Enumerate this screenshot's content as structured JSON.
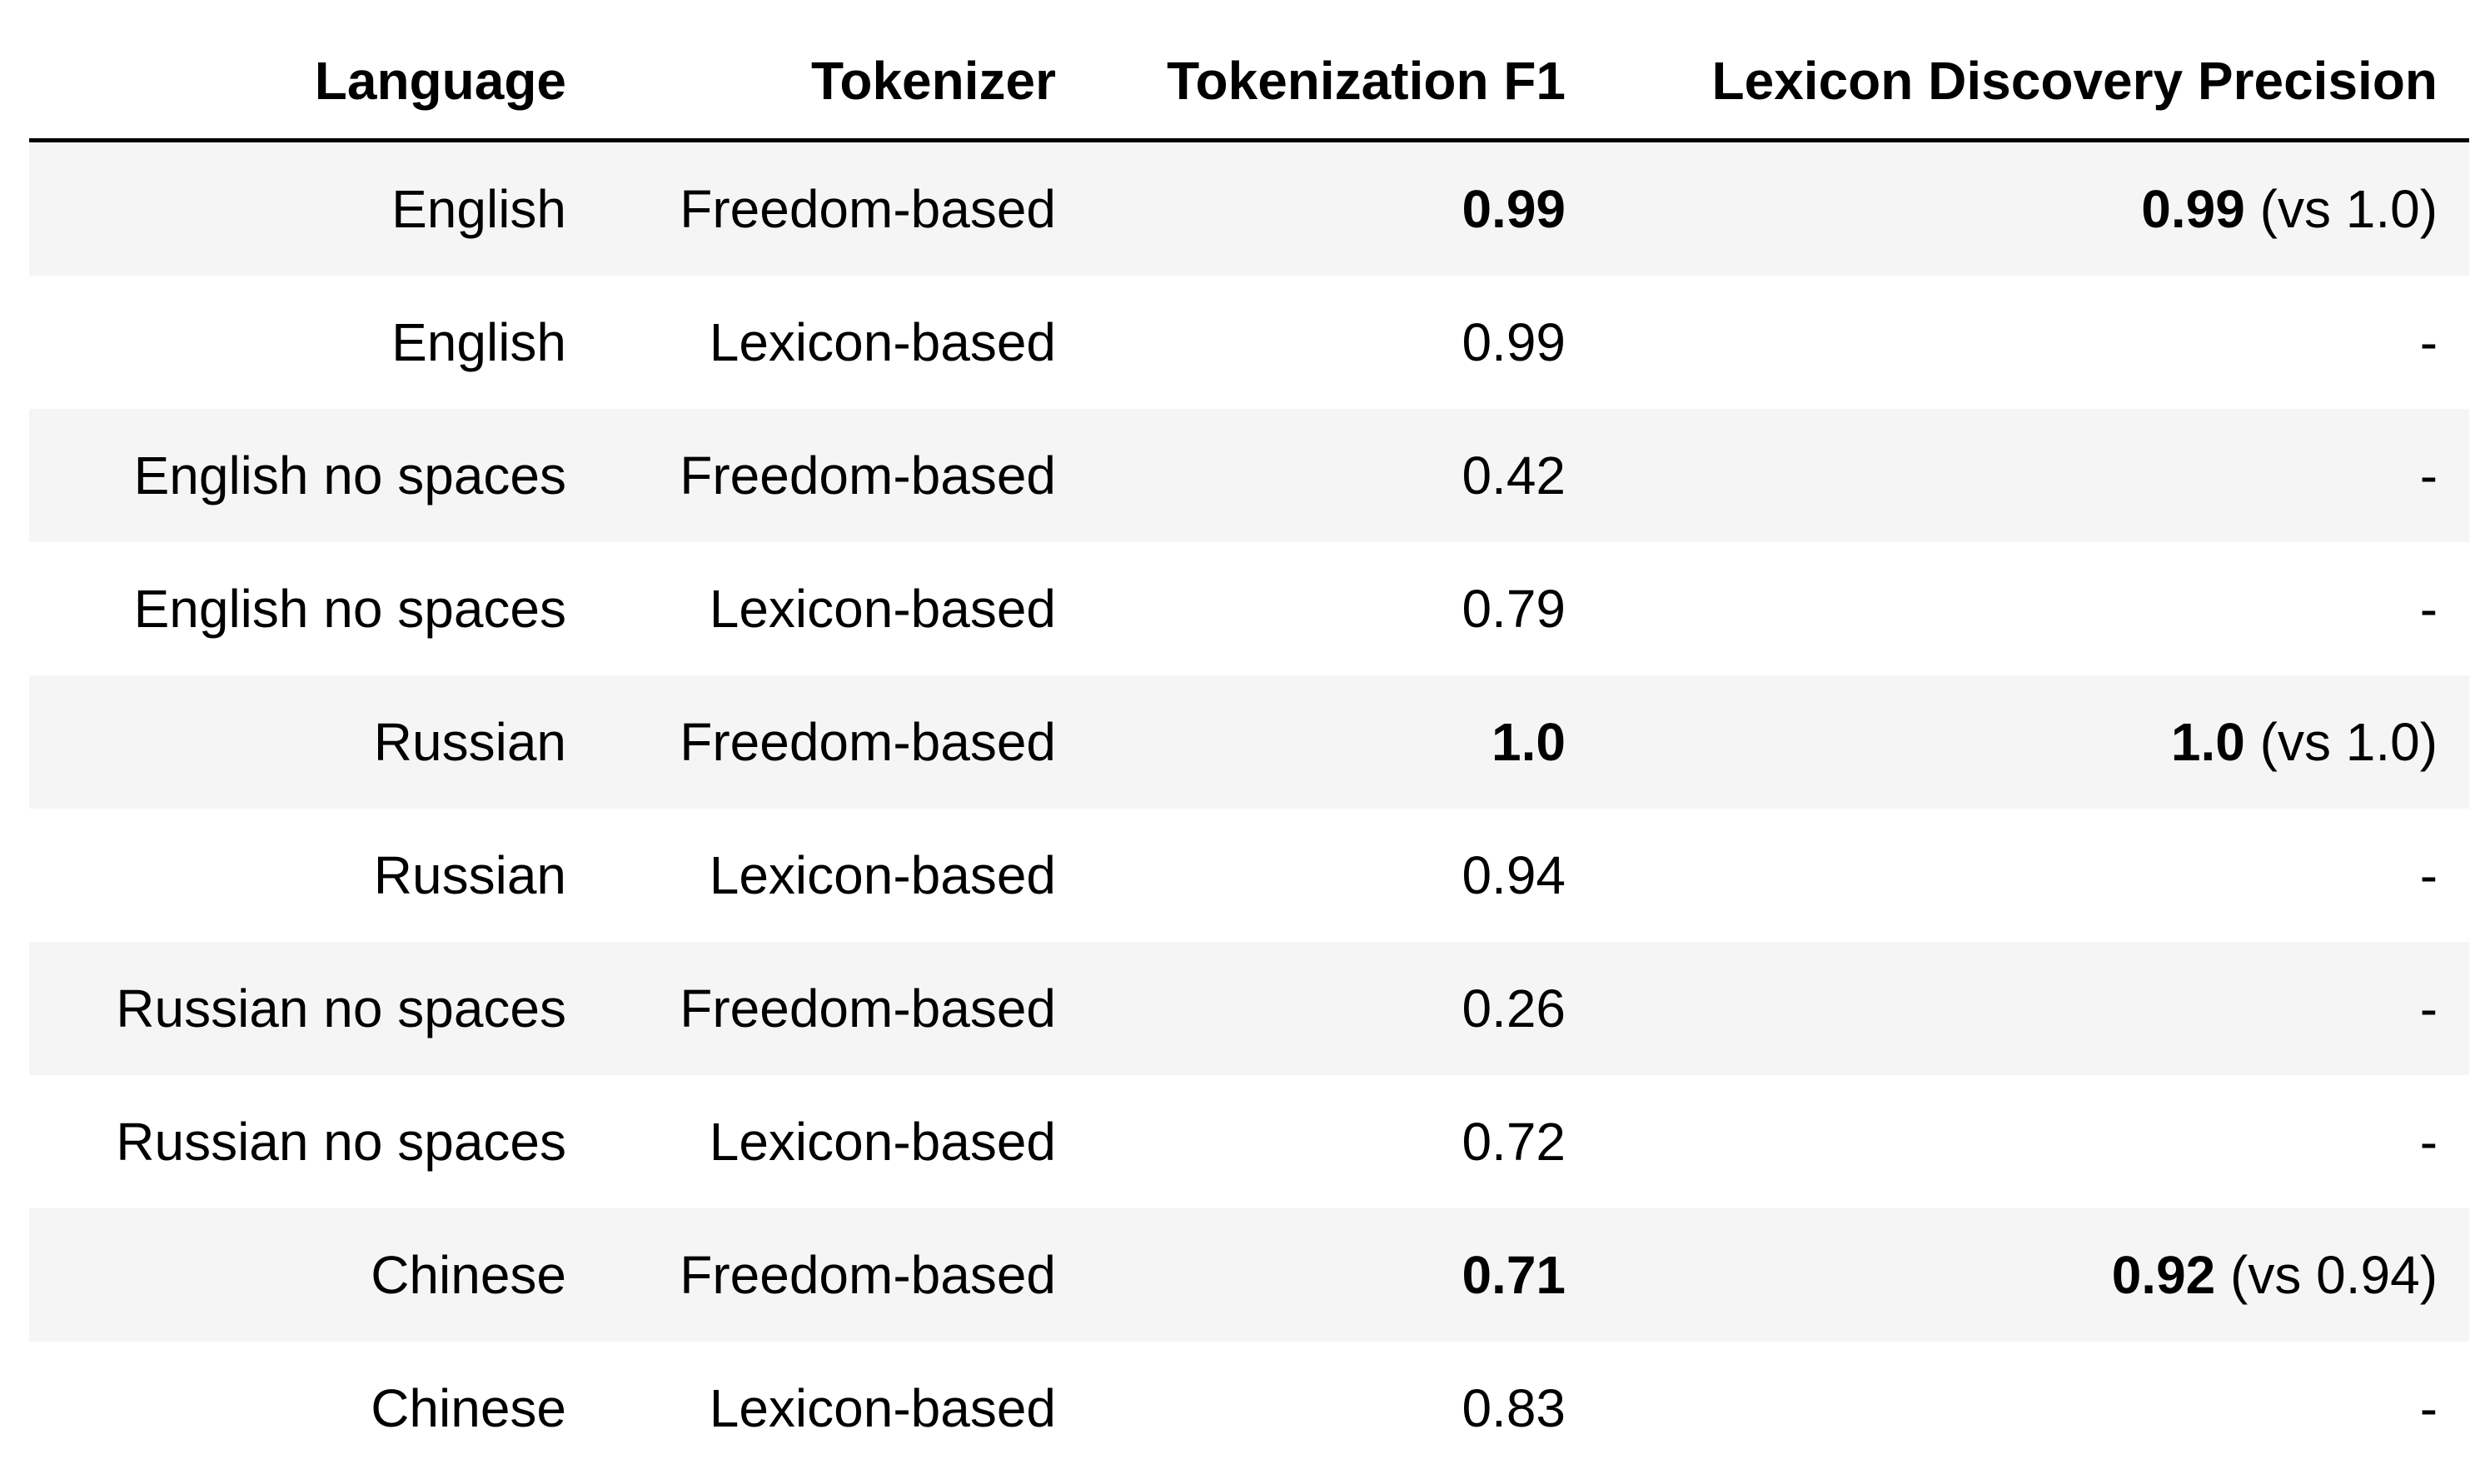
{
  "table": {
    "headers": [
      "Language",
      "Tokenizer",
      "Tokenization F1",
      "Lexicon Discovery Precision"
    ],
    "rows": [
      {
        "language": "English",
        "tokenizer": "Freedom-based",
        "f1": "0.99",
        "f1_bold": true,
        "precision_bold": "0.99",
        "precision_rest": " (vs 1.0)"
      },
      {
        "language": "English",
        "tokenizer": "Lexicon-based",
        "f1": "0.99",
        "f1_bold": false,
        "precision_bold": "",
        "precision_rest": "-"
      },
      {
        "language": "English no spaces",
        "tokenizer": "Freedom-based",
        "f1": "0.42",
        "f1_bold": false,
        "precision_bold": "",
        "precision_rest": "-"
      },
      {
        "language": "English no spaces",
        "tokenizer": "Lexicon-based",
        "f1": "0.79",
        "f1_bold": false,
        "precision_bold": "",
        "precision_rest": "-"
      },
      {
        "language": "Russian",
        "tokenizer": "Freedom-based",
        "f1": "1.0",
        "f1_bold": true,
        "precision_bold": "1.0",
        "precision_rest": " (vs 1.0)"
      },
      {
        "language": "Russian",
        "tokenizer": "Lexicon-based",
        "f1": "0.94",
        "f1_bold": false,
        "precision_bold": "",
        "precision_rest": "-"
      },
      {
        "language": "Russian no spaces",
        "tokenizer": "Freedom-based",
        "f1": "0.26",
        "f1_bold": false,
        "precision_bold": "",
        "precision_rest": "-"
      },
      {
        "language": "Russian no spaces",
        "tokenizer": "Lexicon-based",
        "f1": "0.72",
        "f1_bold": false,
        "precision_bold": "",
        "precision_rest": "-"
      },
      {
        "language": "Chinese",
        "tokenizer": "Freedom-based",
        "f1": "0.71",
        "f1_bold": true,
        "precision_bold": "0.92",
        "precision_rest": " (vs 0.94)"
      },
      {
        "language": "Chinese",
        "tokenizer": "Lexicon-based",
        "f1": "0.83",
        "f1_bold": false,
        "precision_bold": "",
        "precision_rest": "-"
      }
    ]
  }
}
